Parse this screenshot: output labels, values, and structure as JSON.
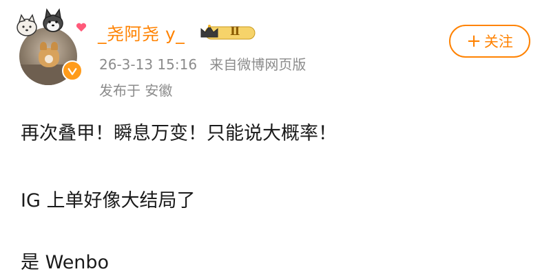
{
  "user": {
    "name": "_尧阿尧 y_",
    "level": "Ⅱ"
  },
  "post_meta": {
    "timestamp": "26-3-13 15:16",
    "source": "来自微博网页版",
    "location": "发布于 安徽"
  },
  "follow_button": {
    "plus": "+",
    "label": "关注"
  },
  "post": {
    "lines": [
      "再次叠甲！瞬息万变！只能说大概率！",
      "IG 上单好像大结局了",
      "是 Wenbo"
    ]
  },
  "colors": {
    "accent": "#ff8200",
    "meta_text": "#8b8b8b",
    "body_text": "#1a1a1a"
  },
  "icons": [
    "avatar",
    "sticker-dog-icon",
    "sticker-husky-icon",
    "heart-icon",
    "verified-badge-icon",
    "crown-icon",
    "plus-icon"
  ]
}
